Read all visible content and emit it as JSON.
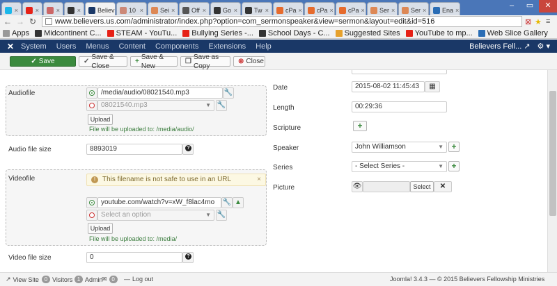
{
  "browser": {
    "tabs": [
      {
        "icon": "vimeo-icon",
        "label": "",
        "color": "#1ab7ea"
      },
      {
        "icon": "youtube-icon",
        "label": "",
        "color": "#e62117"
      },
      {
        "icon": "close-x-icon",
        "label": "",
        "color": "#c66"
      },
      {
        "icon": "joomla-icon",
        "label": "",
        "color": "#333"
      },
      {
        "icon": "joomla-icon",
        "label": "Believ",
        "color": "#1a3867",
        "active": true
      },
      {
        "icon": "pb-icon",
        "label": "10",
        "color": "#c87"
      },
      {
        "icon": "sermon-icon",
        "label": "Sei",
        "color": "#d85"
      },
      {
        "icon": "office-icon",
        "label": "Off",
        "color": "#555"
      },
      {
        "icon": "wiki-icon",
        "label": "Go",
        "color": "#333"
      },
      {
        "icon": "wiki-icon",
        "label": "Tw",
        "color": "#333"
      },
      {
        "icon": "cpanel-icon",
        "label": "cPa",
        "color": "#e66b2d"
      },
      {
        "icon": "cpanel-icon",
        "label": "cPa",
        "color": "#e66b2d"
      },
      {
        "icon": "cpanel-icon",
        "label": "cPa",
        "color": "#e66b2d"
      },
      {
        "icon": "sermon-icon",
        "label": "Ser",
        "color": "#d85"
      },
      {
        "icon": "sermon-icon",
        "label": "Ser",
        "color": "#d85"
      },
      {
        "icon": "globe-icon",
        "label": "Ena",
        "color": "#2a6db5"
      }
    ],
    "url": "www.believers.us.com/administrator/index.php?option=com_sermonspeaker&view=sermon&layout=edit&id=516",
    "bookmarks": [
      {
        "label": "Apps",
        "color": "#999"
      },
      {
        "label": "Midcontinent C...",
        "color": "#333"
      },
      {
        "label": "STEAM - YouTu...",
        "color": "#e62117"
      },
      {
        "label": "Bullying Series -...",
        "color": "#e62117"
      },
      {
        "label": "School Days - C...",
        "color": "#333"
      },
      {
        "label": "Suggested Sites",
        "color": "#e6a12d"
      },
      {
        "label": "YouTube to mp...",
        "color": "#e62117"
      },
      {
        "label": "Web Slice Gallery",
        "color": "#2a6db5"
      }
    ]
  },
  "admin_nav": {
    "menu": [
      "System",
      "Users",
      "Menus",
      "Content",
      "Components",
      "Extensions",
      "Help"
    ],
    "site_name": "Believers Fell...",
    "ext_link_icon": "↗",
    "gear": "⚙ ▾"
  },
  "toolbar": {
    "save": "Save",
    "save_close": "Save & Close",
    "save_new": "Save & New",
    "save_copy": "Save as Copy",
    "close": "Close"
  },
  "form_left": {
    "audiofile_label": "Audiofile",
    "audiofile_path": "/media/audio/08021540.mp3",
    "audiofile_select": "08021540.mp3",
    "upload_label": "Upload",
    "audio_upload_note": "File will be uploaded to: /media/audio/",
    "audio_size_label": "Audio file size",
    "audio_size_value": "8893019",
    "videofile_label": "Videofile",
    "video_warning": "This filename is not safe to use in an URL",
    "video_url": "youtube.com/watch?v=xW_f8lac4mo",
    "video_select_placeholder": "Select an option",
    "video_upload_note": "File will be uploaded to: /media/",
    "video_size_label": "Video file size",
    "video_size_value": "0"
  },
  "form_right": {
    "date_label": "Date",
    "date_value": "2015-08-02 11:45:43",
    "length_label": "Length",
    "length_value": "00:29:36",
    "scripture_label": "Scripture",
    "speaker_label": "Speaker",
    "speaker_value": "John Williamson",
    "series_label": "Series",
    "series_value": "- Select Series -",
    "picture_label": "Picture",
    "picture_select": "Select"
  },
  "statusbar": {
    "view_site": "View Site",
    "visitors_count": "0",
    "visitors_label": "Visitors",
    "admin_count": "1",
    "admin_label": "Admin",
    "messages_count": "0",
    "logout": "Log out",
    "copyright": "Joomla! 3.4.3 — © 2015 Believers Fellowship Ministries"
  }
}
